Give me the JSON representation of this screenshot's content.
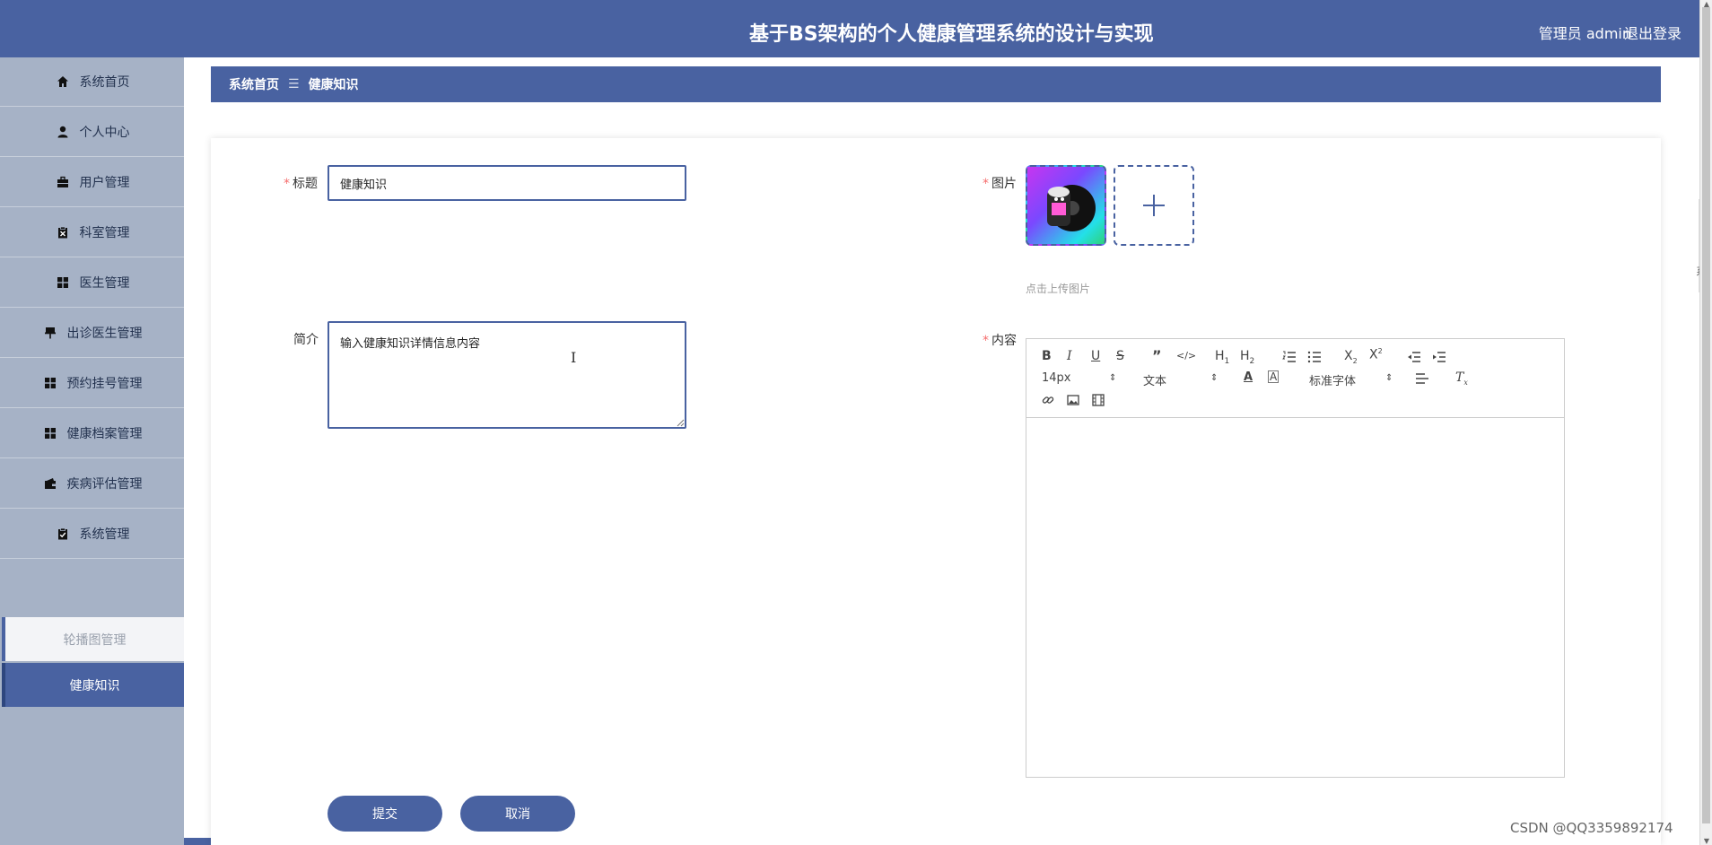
{
  "header": {
    "title": "基于BS架构的个人健康管理系统的设计与实现",
    "user_info": "管理员 admin",
    "logout": "退出登录"
  },
  "sidebar": {
    "items": [
      {
        "label": "系统首页",
        "icon": "home-icon"
      },
      {
        "label": "个人中心",
        "icon": "user-icon"
      },
      {
        "label": "用户管理",
        "icon": "briefcase-icon"
      },
      {
        "label": "科室管理",
        "icon": "clipboard-x-icon"
      },
      {
        "label": "医生管理",
        "icon": "grid-icon"
      },
      {
        "label": "出诊医生管理",
        "icon": "pin-icon"
      },
      {
        "label": "预约挂号管理",
        "icon": "grid-icon"
      },
      {
        "label": "健康档案管理",
        "icon": "grid-icon"
      },
      {
        "label": "疾病评估管理",
        "icon": "wallet-icon"
      },
      {
        "label": "系统管理",
        "icon": "clipboard-check-icon"
      }
    ],
    "subitems": [
      "轮播图管理",
      "健康知识"
    ]
  },
  "breadcrumb": {
    "home": "系统首页",
    "separator": "☰",
    "current": "健康知识"
  },
  "form": {
    "title_label": "标题",
    "title_value": "健康知识",
    "intro_label": "简介",
    "intro_value": "输入健康知识详情信息内容",
    "image_label": "图片",
    "upload_tip": "点击上传图片",
    "content_label": "内容",
    "required_mark": "*"
  },
  "editor": {
    "font_size": "14px",
    "paragraph": "文本",
    "font_family": "标准字体",
    "tools": [
      "B",
      "I",
      "U",
      "S",
      "quote",
      "code",
      "H1",
      "H2",
      "ordered-list",
      "bullet-list",
      "subscript",
      "superscript",
      "outdent",
      "indent",
      "font-color",
      "background-color",
      "align",
      "clear-format",
      "link",
      "image",
      "video"
    ]
  },
  "buttons": {
    "submit": "提交",
    "cancel": "取消"
  },
  "watermark": "CSDN @QQ3359892174",
  "peek_text": "系统",
  "colors": {
    "primary": "#4962a1",
    "sidebar_bg": "#a6b2c6",
    "required": "#f56c6c"
  }
}
